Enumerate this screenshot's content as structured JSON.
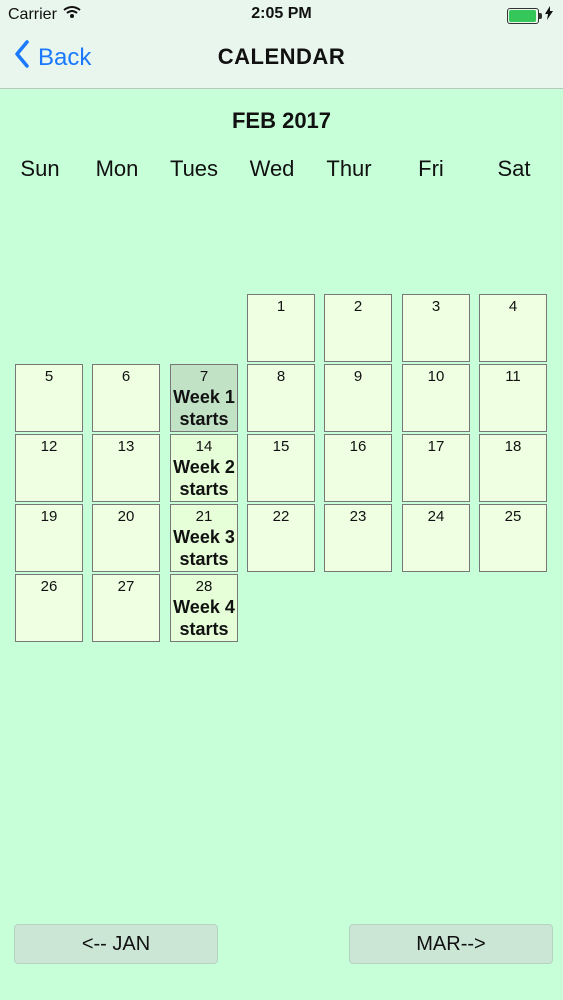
{
  "status": {
    "carrier": "Carrier",
    "time": "2:05 PM"
  },
  "nav": {
    "back_label": "Back",
    "title": "CALENDAR"
  },
  "calendar": {
    "month_title": "FEB 2017",
    "weekdays": [
      "Sun",
      "Mon",
      "Tues",
      "Wed",
      "Thur",
      "Fri",
      "Sat"
    ],
    "days": [
      {
        "num": "1",
        "note": ""
      },
      {
        "num": "2",
        "note": ""
      },
      {
        "num": "3",
        "note": ""
      },
      {
        "num": "4",
        "note": ""
      },
      {
        "num": "5",
        "note": ""
      },
      {
        "num": "6",
        "note": ""
      },
      {
        "num": "7",
        "note": "Week 1 starts"
      },
      {
        "num": "8",
        "note": ""
      },
      {
        "num": "9",
        "note": ""
      },
      {
        "num": "10",
        "note": ""
      },
      {
        "num": "11",
        "note": ""
      },
      {
        "num": "12",
        "note": ""
      },
      {
        "num": "13",
        "note": ""
      },
      {
        "num": "14",
        "note": "Week 2 starts"
      },
      {
        "num": "15",
        "note": ""
      },
      {
        "num": "16",
        "note": ""
      },
      {
        "num": "17",
        "note": ""
      },
      {
        "num": "18",
        "note": ""
      },
      {
        "num": "19",
        "note": ""
      },
      {
        "num": "20",
        "note": ""
      },
      {
        "num": "21",
        "note": "Week 3 starts"
      },
      {
        "num": "22",
        "note": ""
      },
      {
        "num": "23",
        "note": ""
      },
      {
        "num": "24",
        "note": ""
      },
      {
        "num": "25",
        "note": ""
      },
      {
        "num": "26",
        "note": ""
      },
      {
        "num": "27",
        "note": ""
      },
      {
        "num": "28",
        "note": "Week 4 starts"
      }
    ]
  },
  "footer": {
    "prev_label": "<-- JAN",
    "next_label": "MAR-->"
  },
  "colors": {
    "background": "#c6ffd8",
    "cell": "#efffe2",
    "selected_cell": "#c2e2c6",
    "link": "#1a79ff"
  }
}
